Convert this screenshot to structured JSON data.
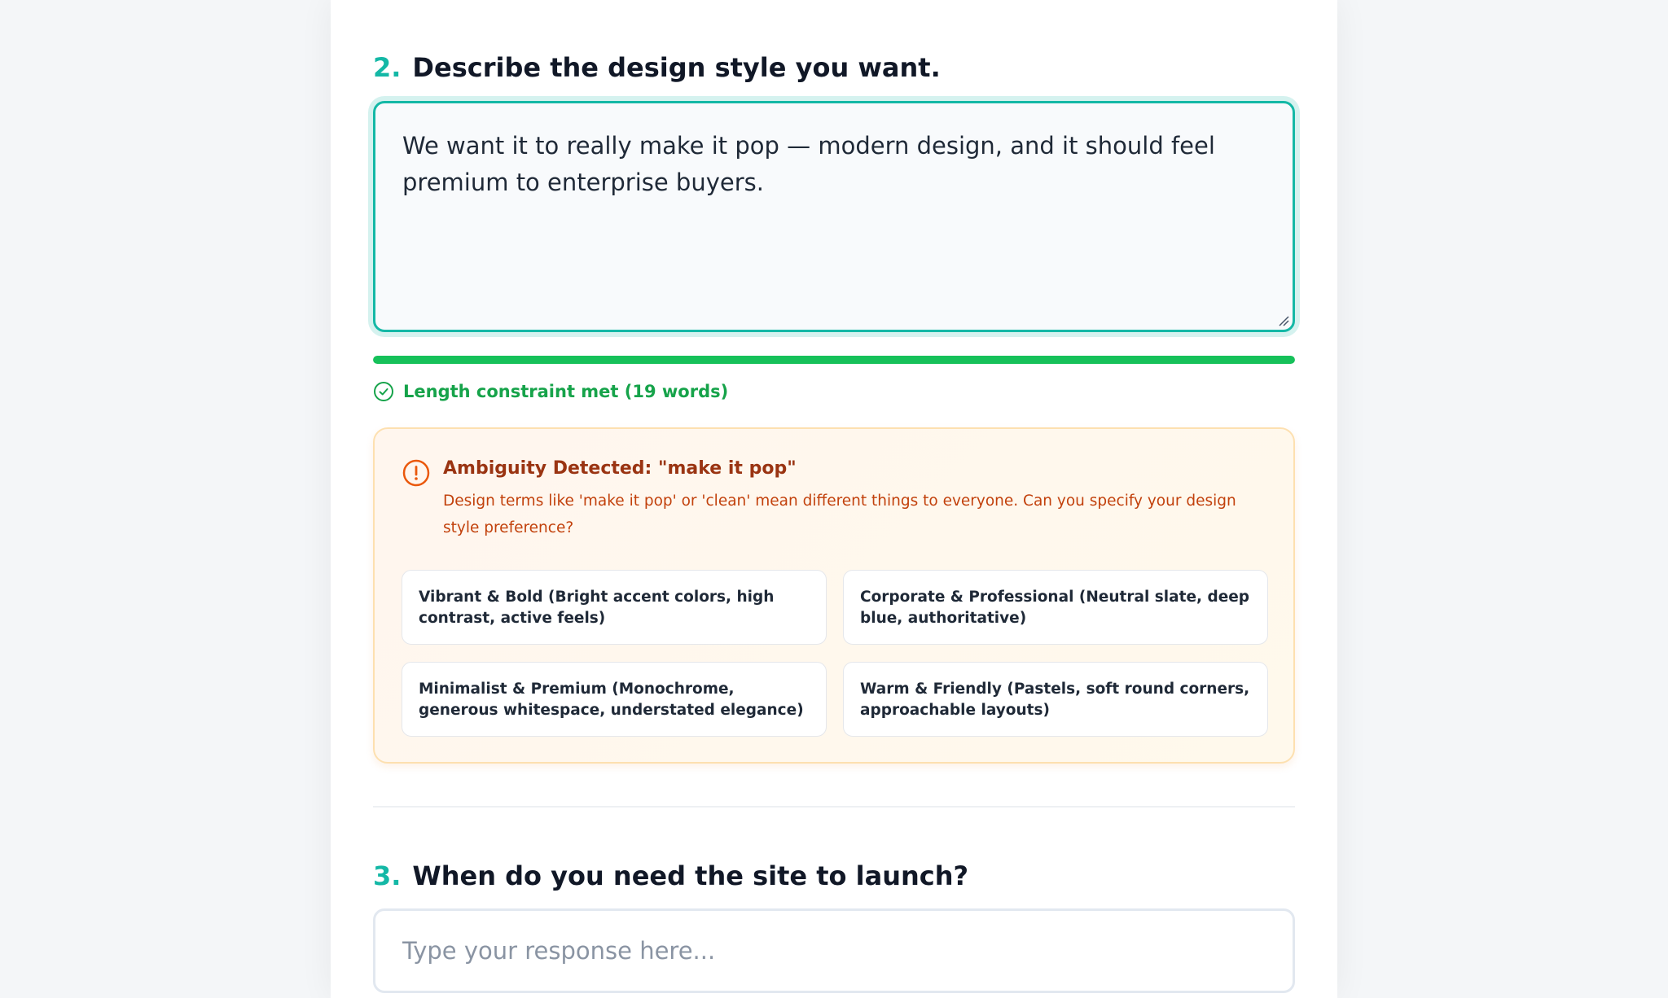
{
  "colors": {
    "accent": "#14b8a6",
    "success": "#16a34a",
    "progress_fill": "#16c15a",
    "warning_title": "#9a3412",
    "warning_text": "#c2410c",
    "warning_icon": "#ea580c"
  },
  "question2": {
    "number": "2.",
    "title": "Describe the design style you want.",
    "response": "We want it to really make it pop — modern design, and it should feel premium to enterprise buyers.",
    "progress_fraction": 1.0,
    "status_icon": "check-circle-icon",
    "status_text": "Length constraint met (19 words)"
  },
  "ambiguity": {
    "icon": "alert-circle-icon",
    "title": "Ambiguity Detected: \"make it pop\"",
    "description": "Design terms like 'make it pop' or 'clean' mean different things to everyone. Can you specify your design style preference?",
    "options": [
      "Vibrant & Bold (Bright accent colors, high contrast, active feels)",
      "Corporate & Professional (Neutral slate, deep blue, authoritative)",
      "Minimalist & Premium (Monochrome, generous whitespace, understated elegance)",
      "Warm & Friendly (Pastels, soft round corners, approachable layouts)"
    ]
  },
  "question3": {
    "number": "3.",
    "title": "When do you need the site to launch?",
    "placeholder": "Type your response here..."
  }
}
